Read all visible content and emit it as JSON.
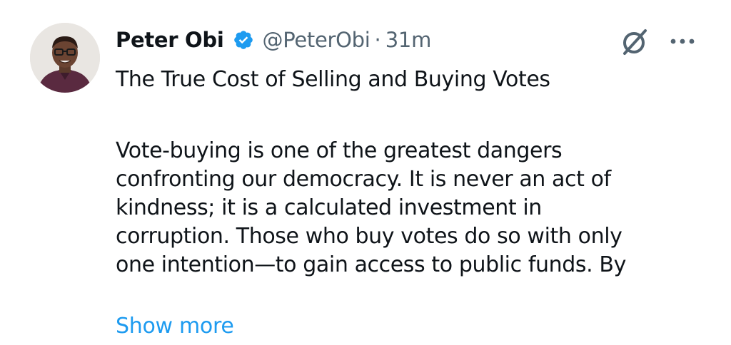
{
  "tweet": {
    "author_name": "Peter Obi",
    "handle": "@PeterObi",
    "separator": "·",
    "time": "31m",
    "verified": true,
    "title": "The True Cost of Selling and Buying Votes",
    "body_lines": [
      "Vote-buying is one of the greatest dangers",
      "confronting our democracy. It is never an act of",
      "kindness; it is a calculated investment in",
      "corruption. Those who buy votes do so with only",
      "one intention—to gain access to public funds. By"
    ],
    "show_more_label": "Show more"
  },
  "icons": {
    "verified": "verified-badge-icon",
    "grok": "grok-icon",
    "more": "more-options-icon"
  },
  "colors": {
    "accent": "#1d9bf0",
    "text": "#0f1419",
    "secondary_text": "#536471"
  }
}
